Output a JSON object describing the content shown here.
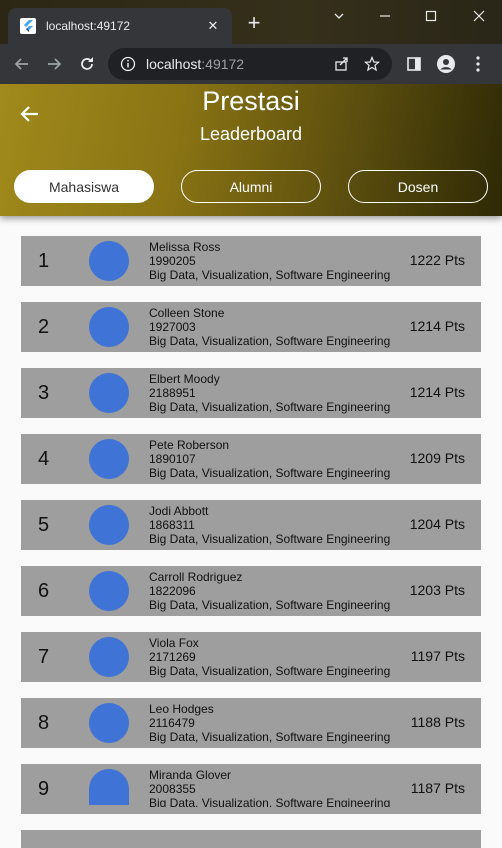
{
  "browser": {
    "tab_title": "localhost:49172",
    "url_host": "localhost",
    "url_port": ":49172",
    "icons": [
      "flutter-favicon",
      "close-icon",
      "plus-icon",
      "chevron-down-icon",
      "minimize-icon",
      "maximize-icon",
      "close-window-icon",
      "back-arrow-icon",
      "forward-arrow-icon",
      "reload-icon",
      "info-icon",
      "share-icon",
      "star-icon",
      "sidebar-icon",
      "profile-icon",
      "more-vert-icon"
    ]
  },
  "app": {
    "title": "Prestasi",
    "subtitle": "Leaderboard",
    "tabs": [
      {
        "label": "Mahasiswa",
        "active": true
      },
      {
        "label": "Alumni",
        "active": false
      },
      {
        "label": "Dosen",
        "active": false
      }
    ],
    "colors": {
      "avatar": "#3f74d6",
      "row_bg": "#9e9e9e",
      "header_gold": "#a08a1c",
      "header_dark": "#2e2906"
    },
    "leaderboard": [
      {
        "rank": "1",
        "name": "Melissa Ross",
        "id": "1990205",
        "interests": "Big Data, Visualization, Software Engineering",
        "points": "1222 Pts"
      },
      {
        "rank": "2",
        "name": "Colleen Stone",
        "id": "1927003",
        "interests": "Big Data, Visualization, Software Engineering",
        "points": "1214 Pts"
      },
      {
        "rank": "3",
        "name": "Elbert Moody",
        "id": "2188951",
        "interests": "Big Data, Visualization, Software Engineering",
        "points": "1214 Pts"
      },
      {
        "rank": "4",
        "name": "Pete Roberson",
        "id": "1890107",
        "interests": "Big Data, Visualization, Software Engineering",
        "points": "1209 Pts"
      },
      {
        "rank": "5",
        "name": "Jodi Abbott",
        "id": "1868311",
        "interests": "Big Data, Visualization, Software Engineering",
        "points": "1204 Pts"
      },
      {
        "rank": "6",
        "name": "Carroll Rodriguez",
        "id": "1822096",
        "interests": "Big Data, Visualization, Software Engineering",
        "points": "1203 Pts"
      },
      {
        "rank": "7",
        "name": "Viola Fox",
        "id": "2171269",
        "interests": "Big Data, Visualization, Software Engineering",
        "points": "1197 Pts"
      },
      {
        "rank": "8",
        "name": "Leo Hodges",
        "id": "2116479",
        "interests": "Big Data, Visualization, Software Engineering",
        "points": "1188 Pts"
      },
      {
        "rank": "9",
        "name": "Miranda Glover",
        "id": "2008355",
        "interests": "Big Data, Visualization, Software Engineering",
        "points": "1187 Pts"
      }
    ]
  }
}
